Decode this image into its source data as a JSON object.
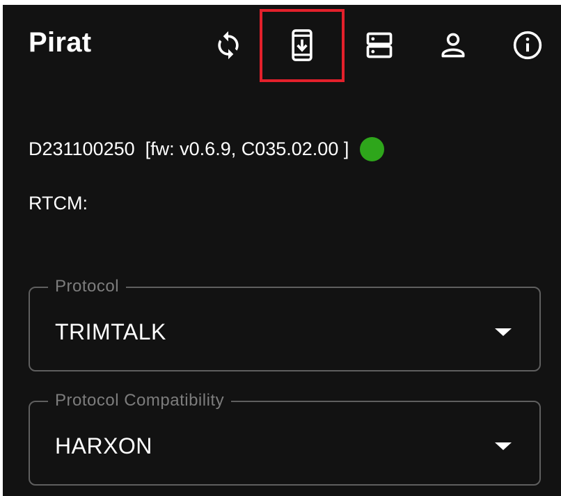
{
  "app": {
    "title": "Pirat"
  },
  "toolbar": {
    "icons": [
      "sync-icon",
      "phone-download-icon",
      "server-icon",
      "user-icon",
      "info-icon"
    ]
  },
  "device": {
    "id": "D231100250",
    "firmware": "[fw: v0.6.9, C035.02.00 ]",
    "status_color": "#2ea61b"
  },
  "rtcm": {
    "label": "RTCM:"
  },
  "protocol": {
    "label": "Protocol",
    "value": "TRIMTALK"
  },
  "compatibility": {
    "label": "Protocol Compatibility",
    "value": "HARXON"
  },
  "colors": {
    "background": "#121212",
    "highlight": "#e3202b",
    "border": "#5f5f5f"
  }
}
